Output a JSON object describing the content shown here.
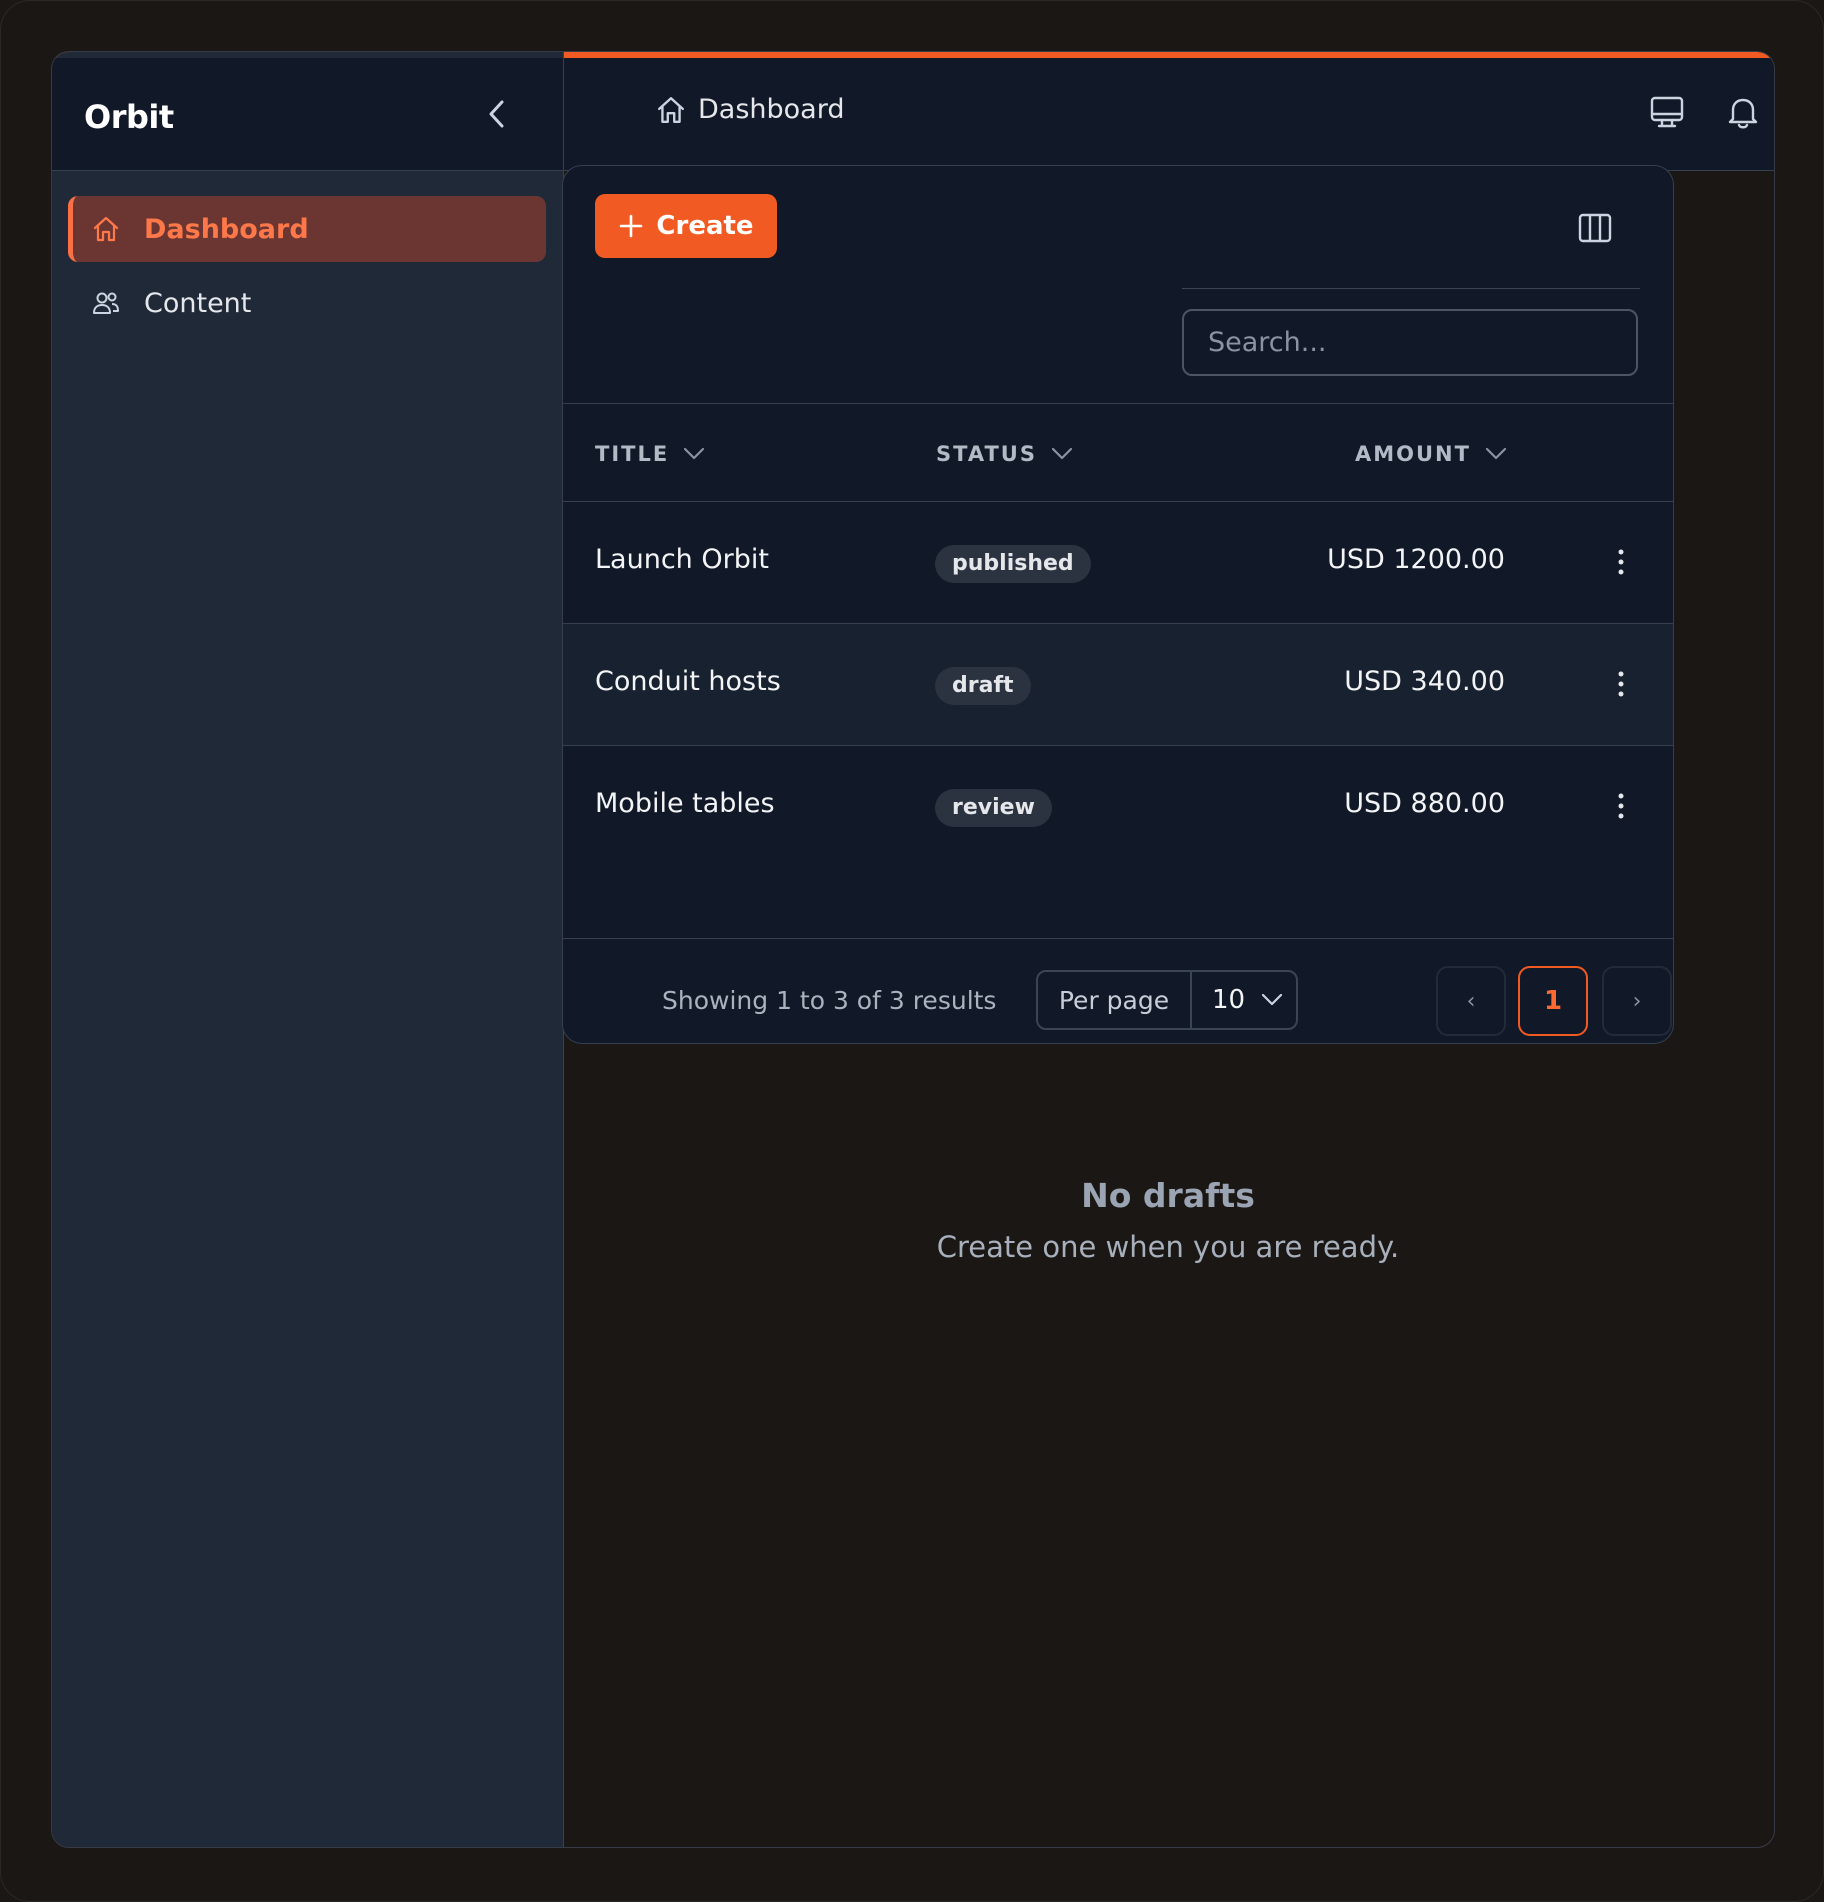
{
  "app": {
    "brand": "Orbit"
  },
  "sidebar": {
    "items": [
      {
        "label": "Dashboard",
        "icon": "home-icon",
        "active": true
      },
      {
        "label": "Content",
        "icon": "users-icon",
        "active": false
      }
    ]
  },
  "header": {
    "breadcrumb": "Dashboard"
  },
  "toolbar": {
    "create_label": "Create",
    "search_placeholder": "Search..."
  },
  "table": {
    "columns": [
      "TITLE",
      "STATUS",
      "AMOUNT"
    ],
    "rows": [
      {
        "title": "Launch Orbit",
        "status": "published",
        "amount": "USD 1200.00"
      },
      {
        "title": "Conduit hosts",
        "status": "draft",
        "amount": "USD 340.00"
      },
      {
        "title": "Mobile tables",
        "status": "review",
        "amount": "USD 880.00"
      }
    ]
  },
  "pagination": {
    "summary": "Showing 1 to 3 of 3 results",
    "per_page_label": "Per page",
    "per_page_value": "10",
    "prev": "‹",
    "current_page": "1",
    "next": "›"
  },
  "empty_state": {
    "title": "No drafts",
    "subtitle": "Create one when you are ready."
  },
  "colors": {
    "accent": "#f15a22",
    "sidebar_bg": "#1f2937",
    "card_bg": "#111827",
    "page_bg": "#1b1714"
  }
}
